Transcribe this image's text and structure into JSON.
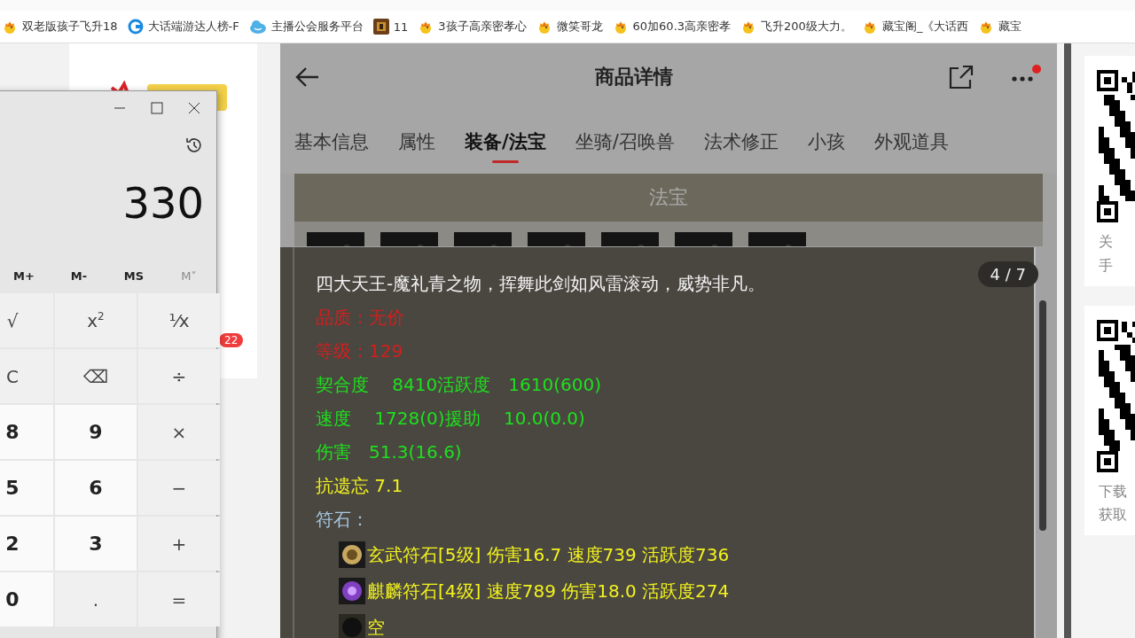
{
  "bookmarks": [
    {
      "kind": "chick",
      "label": "双老版孩子飞升18"
    },
    {
      "kind": "browser",
      "label": "大话端游达人榜-F"
    },
    {
      "kind": "cloud",
      "label": "主播公会服务平台"
    },
    {
      "kind": "game",
      "label": "11"
    },
    {
      "kind": "chick",
      "label": "3孩子高亲密孝心"
    },
    {
      "kind": "chick",
      "label": "微笑哥龙"
    },
    {
      "kind": "chick",
      "label": "60加60.3高亲密孝"
    },
    {
      "kind": "chick",
      "label": "飞升200级大力。"
    },
    {
      "kind": "chick",
      "label": "藏宝阁_《大话西"
    },
    {
      "kind": "chick",
      "label": "藏宝"
    }
  ],
  "calculator": {
    "display": "330",
    "memory": [
      {
        "label": "M+",
        "disabled": false
      },
      {
        "label": "M-",
        "disabled": false
      },
      {
        "label": "MS",
        "disabled": false
      },
      {
        "label": "M˅",
        "disabled": true
      }
    ],
    "keys": [
      {
        "label": "√",
        "kind": "fn"
      },
      {
        "label": "x$^{2}$",
        "kind": "fn"
      },
      {
        "label": "¹⁄x",
        "kind": "fn"
      },
      {
        "label": "C",
        "kind": "fn"
      },
      {
        "label": "⌫",
        "kind": "fn"
      },
      {
        "label": "÷",
        "kind": "fn"
      },
      {
        "label": "8",
        "kind": "digit"
      },
      {
        "label": "9",
        "kind": "digit"
      },
      {
        "label": "×",
        "kind": "fn"
      },
      {
        "label": "5",
        "kind": "digit"
      },
      {
        "label": "6",
        "kind": "digit"
      },
      {
        "label": "−",
        "kind": "fn"
      },
      {
        "label": "2",
        "kind": "digit"
      },
      {
        "label": "3",
        "kind": "digit"
      },
      {
        "label": "+",
        "kind": "fn"
      },
      {
        "label": "0",
        "kind": "digit"
      },
      {
        "label": ".",
        "kind": "fn"
      },
      {
        "label": "=",
        "kind": "fn"
      }
    ]
  },
  "page_badge": "22",
  "detail": {
    "title": "商品详情",
    "tabs": [
      {
        "label": "基本信息",
        "selected": false
      },
      {
        "label": "属性",
        "selected": false
      },
      {
        "label": "装备/法宝",
        "selected": true
      },
      {
        "label": "坐骑/召唤兽",
        "selected": false
      },
      {
        "label": "法术修正",
        "selected": false
      },
      {
        "label": "小孩",
        "selected": false
      },
      {
        "label": "外观道具",
        "selected": false
      }
    ],
    "section_title": "法宝",
    "tooltip": {
      "counter": "4 / 7",
      "lines": [
        {
          "text": "四大天王-魔礼青之物，挥舞此剑如风雷滚动，威势非凡。",
          "color": "#f2f2f2"
        },
        {
          "text": "品质：无价",
          "color": "#d41e1e"
        },
        {
          "text": "等级：129",
          "color": "#d41e1e"
        },
        {
          "text": "契合度　 8410活跃度　1610(600)",
          "color": "#1ee01e"
        },
        {
          "text": "速度　 1728(0)援助　 10.0(0.0)",
          "color": "#1ee01e"
        },
        {
          "text": "伤害　51.3(16.6)",
          "color": "#1ee01e"
        },
        {
          "text": "抗遗忘 7.1",
          "color": "#f2f21e"
        },
        {
          "text": "符石：",
          "color": "#a8c8e0"
        }
      ],
      "runes": [
        {
          "kind": "gold",
          "text": "玄武符石[5级] 伤害16.7 速度739 活跃度736",
          "color": "#f2f21e"
        },
        {
          "kind": "purple",
          "text": "麒麟符石[4级] 速度789 伤害18.0 活跃度274",
          "color": "#f2f21e"
        },
        {
          "kind": "empty",
          "text": "空",
          "color": "#f2f21e"
        }
      ]
    }
  },
  "qr_cards": [
    {
      "lines": [
        "关",
        "手"
      ]
    },
    {
      "lines": [
        "下载",
        "获取"
      ]
    }
  ]
}
